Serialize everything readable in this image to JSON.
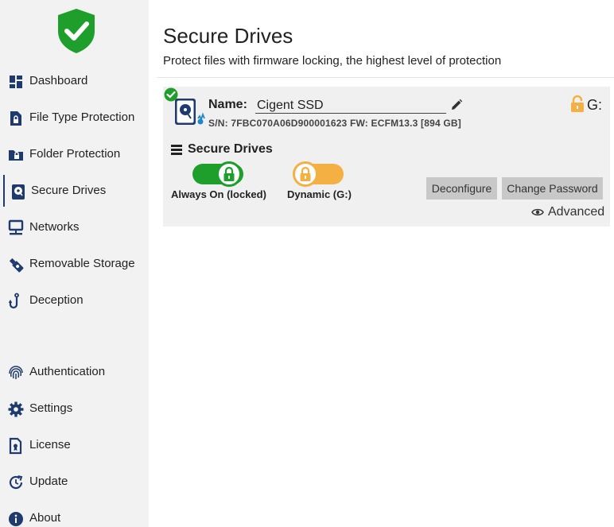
{
  "sidebar": {
    "logo_icon": "shield-check-icon",
    "items": [
      {
        "label": "Dashboard",
        "icon": "dashboard-icon"
      },
      {
        "label": "File Type Protection",
        "icon": "file-lock-icon"
      },
      {
        "label": "Folder Protection",
        "icon": "folder-lock-icon"
      },
      {
        "label": "Secure Drives",
        "icon": "secure-drive-icon",
        "active": true
      },
      {
        "label": "Networks",
        "icon": "network-icon"
      },
      {
        "label": "Removable Storage",
        "icon": "usb-icon"
      },
      {
        "label": "Deception",
        "icon": "hook-icon"
      },
      {
        "label": "Authentication",
        "icon": "fingerprint-icon"
      },
      {
        "label": "Settings",
        "icon": "gear-icon"
      },
      {
        "label": "License",
        "icon": "license-icon"
      },
      {
        "label": "Update",
        "icon": "update-icon"
      },
      {
        "label": "About",
        "icon": "info-icon"
      }
    ]
  },
  "main": {
    "title": "Secure Drives",
    "subtitle": "Protect files with firmware locking, the highest level of protection"
  },
  "drive": {
    "name_label": "Name:",
    "name_value": "Cigent SSD",
    "meta": "S/N: 7FBC070A06D900001623 FW: ECFM13.3 [894 GB]",
    "drive_letter": "G:",
    "section_title": "Secure Drives",
    "modes": [
      {
        "label": "Always On (locked)",
        "state": "on"
      },
      {
        "label": "Dynamic (G:)",
        "state": "dynamic"
      }
    ],
    "deconfigure_label": "Deconfigure",
    "change_password_label": "Change Password",
    "advanced_label": "Advanced"
  },
  "colors": {
    "brand_green": "#1e9e2a",
    "dynamic_orange": "#f5b043",
    "nav_icon": "#1f3a6e",
    "sidebar_bg": "#f2f2f2"
  }
}
